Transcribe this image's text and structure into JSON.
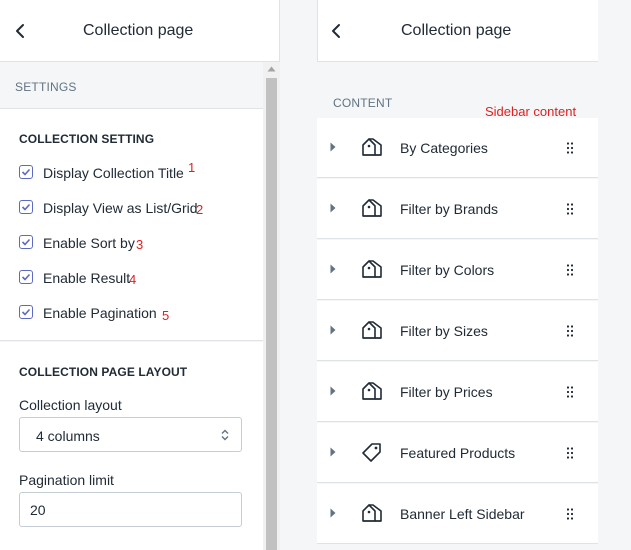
{
  "left_panel": {
    "header": {
      "title": "Collection page"
    },
    "settings_label": "SETTINGS",
    "collection_setting": {
      "heading": "COLLECTION SETTING",
      "checkboxes": [
        {
          "label": "Display Collection Title",
          "checked": true,
          "annotation": "1"
        },
        {
          "label": "Display View as List/Grid",
          "checked": true,
          "annotation": "2"
        },
        {
          "label": "Enable Sort by",
          "checked": true,
          "annotation": "3"
        },
        {
          "label": "Enable Result",
          "checked": true,
          "annotation": "4"
        },
        {
          "label": "Enable Pagination",
          "checked": true,
          "annotation": "5"
        }
      ]
    },
    "layout_section": {
      "heading": "COLLECTION PAGE LAYOUT",
      "collection_layout_label": "Collection layout",
      "collection_layout_value": "4 columns",
      "pagination_label": "Pagination limit",
      "pagination_value": "20"
    }
  },
  "right_panel": {
    "header": {
      "title": "Collection page"
    },
    "content_label": "CONTENT",
    "content_annotation": "Sidebar content",
    "blocks": [
      {
        "label": "By Categories",
        "icon": "section-icon"
      },
      {
        "label": "Filter by Brands",
        "icon": "section-icon"
      },
      {
        "label": "Filter by Colors",
        "icon": "section-icon"
      },
      {
        "label": "Filter by Sizes",
        "icon": "section-icon"
      },
      {
        "label": "Filter by Prices",
        "icon": "section-icon"
      },
      {
        "label": "Featured Products",
        "icon": "tag-icon"
      },
      {
        "label": "Banner Left Sidebar",
        "icon": "section-icon"
      }
    ]
  },
  "colors": {
    "checkbox_accent": "#5c6ac4",
    "annotation": "#e02020",
    "panel_bg": "#f4f6f8",
    "border": "#dfe3e8"
  }
}
